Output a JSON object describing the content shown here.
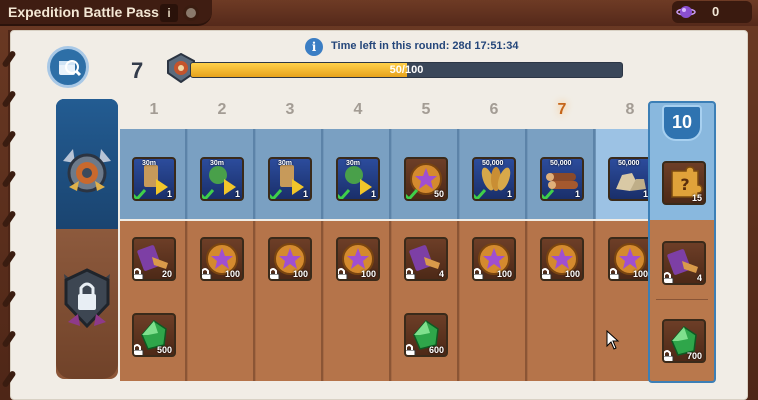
{
  "header": {
    "title": "Expedition Battle Pass",
    "info_label": "i",
    "currency_value": "0"
  },
  "round": {
    "info_icon": "i",
    "time_left_text": "Time left in this round: 28d 17:51:34"
  },
  "level": {
    "current": "7",
    "progress_current": "50",
    "progress_sep": "/",
    "progress_max": "100",
    "progress_fraction": 0.5
  },
  "levels": [
    "1",
    "2",
    "3",
    "4",
    "5",
    "6",
    "7",
    "8"
  ],
  "current_level_index": 6,
  "premium_level": "10",
  "free_rewards": [
    {
      "amount": "30m",
      "qty": "1",
      "icon": "troop-speedup-icon",
      "style": "blue",
      "claimed": true
    },
    {
      "amount": "30m",
      "qty": "1",
      "icon": "healing-speedup-icon",
      "style": "blue",
      "claimed": true
    },
    {
      "amount": "30m",
      "qty": "1",
      "icon": "troop-speedup-icon",
      "style": "blue",
      "claimed": true
    },
    {
      "amount": "30m",
      "qty": "1",
      "icon": "healing-speedup-icon",
      "style": "blue",
      "claimed": true
    },
    {
      "amount": "",
      "qty": "50",
      "icon": "purple-coin-icon",
      "style": "brown",
      "claimed": true
    },
    {
      "amount": "50,000",
      "qty": "1",
      "icon": "wheat-icon",
      "style": "blue",
      "claimed": true
    },
    {
      "amount": "50,000",
      "qty": "1",
      "icon": "wood-icon",
      "style": "blue",
      "claimed": true
    },
    {
      "amount": "50,000",
      "qty": "1",
      "icon": "stone-icon",
      "style": "blue",
      "claimed": false
    }
  ],
  "premium_free_reward": {
    "qty": "15",
    "icon": "mystery-puzzle-icon"
  },
  "paid_rewards_row1": [
    {
      "qty": "20",
      "icon": "scroll-key-icon"
    },
    {
      "qty": "100",
      "icon": "purple-coin-icon"
    },
    {
      "qty": "100",
      "icon": "purple-coin-icon"
    },
    {
      "qty": "100",
      "icon": "purple-coin-icon"
    },
    {
      "qty": "4",
      "icon": "scroll-key-icon"
    },
    {
      "qty": "100",
      "icon": "purple-coin-icon"
    },
    {
      "qty": "100",
      "icon": "purple-coin-icon"
    },
    {
      "qty": "100",
      "icon": "purple-coin-icon"
    }
  ],
  "paid_rewards_row2": [
    {
      "qty": "500",
      "icon": "emerald-icon",
      "col": 0
    },
    {
      "qty": "600",
      "icon": "emerald-icon",
      "col": 4
    }
  ],
  "premium_paid": [
    {
      "qty": "4",
      "icon": "scroll-key-icon"
    },
    {
      "qty": "700",
      "icon": "emerald-icon"
    }
  ],
  "colors": {
    "paper": "#f1ede6",
    "free_row": "#7aa0c2",
    "paid_row": "#b5744a",
    "progress_fill": "#e6a21c",
    "current_level": "#c5651a"
  }
}
